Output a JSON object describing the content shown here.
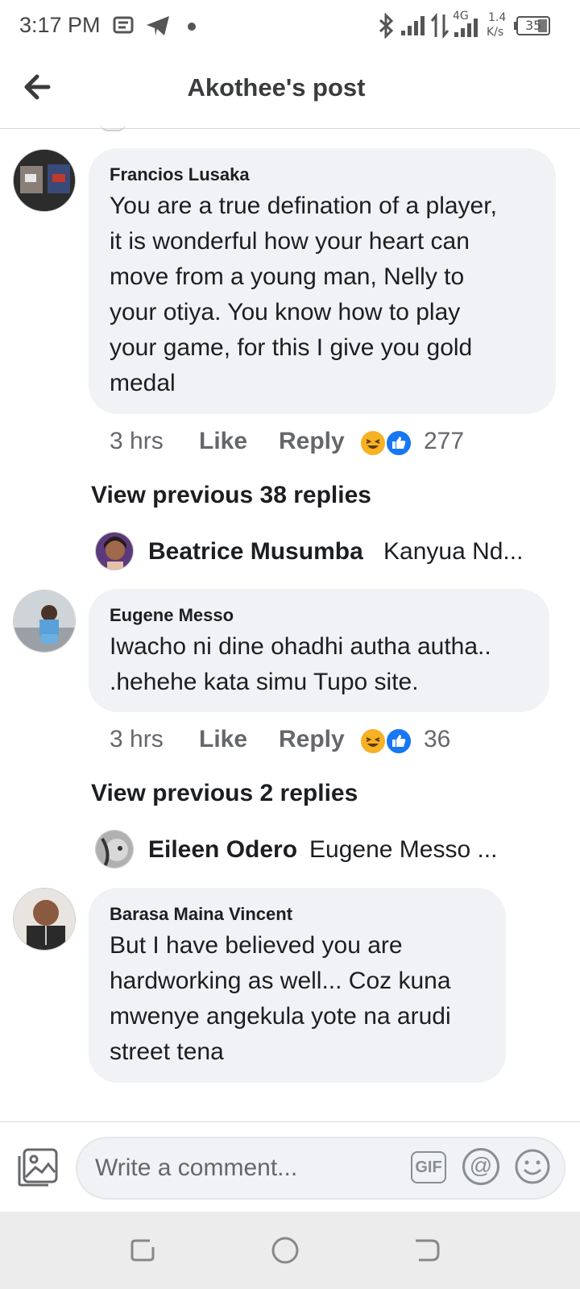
{
  "status_bar": {
    "time": "3:17 PM",
    "network_type": "4G",
    "speed_value": "1.4",
    "speed_unit": "K/s",
    "battery": "35"
  },
  "header": {
    "title": "Akothee's post"
  },
  "comments": [
    {
      "author": "Francios Lusaka",
      "text_lines": [
        "You are a true defination of a player,",
        "it is wonderful how your heart can",
        "move from a young man, Nelly to",
        "your otiya. You know how to play",
        "your game, for this I give you gold",
        "medal"
      ],
      "time": "3 hrs",
      "like_label": "Like",
      "reply_label": "Reply",
      "reaction_count": "277",
      "view_previous": "View previous 38 replies",
      "last_reply": {
        "author": "Beatrice Musumba",
        "snippet": "Kanyua Nd..."
      }
    },
    {
      "author": "Eugene Messo",
      "text_lines": [
        "Iwacho ni dine ohadhi autha autha..",
        ".hehehe kata simu Tupo site."
      ],
      "time": "3 hrs",
      "like_label": "Like",
      "reply_label": "Reply",
      "reaction_count": "36",
      "view_previous": "View previous 2 replies",
      "last_reply": {
        "author": "Eileen Odero",
        "snippet": "Eugene Messo ..."
      }
    },
    {
      "author": "Barasa Maina Vincent",
      "text_lines": [
        "But I have believed you are",
        "hardworking as well... Coz kuna",
        "mwenye angekula yote na arudi",
        "street tena"
      ]
    }
  ],
  "composer": {
    "placeholder": "Write a comment...",
    "gif_label": "GIF",
    "at_label": "@"
  },
  "colors": {
    "bubble": "#f0f2f5",
    "like_blue": "#1877f2",
    "laugh_yellow": "#f7b125",
    "meta_gray": "#65676b"
  }
}
